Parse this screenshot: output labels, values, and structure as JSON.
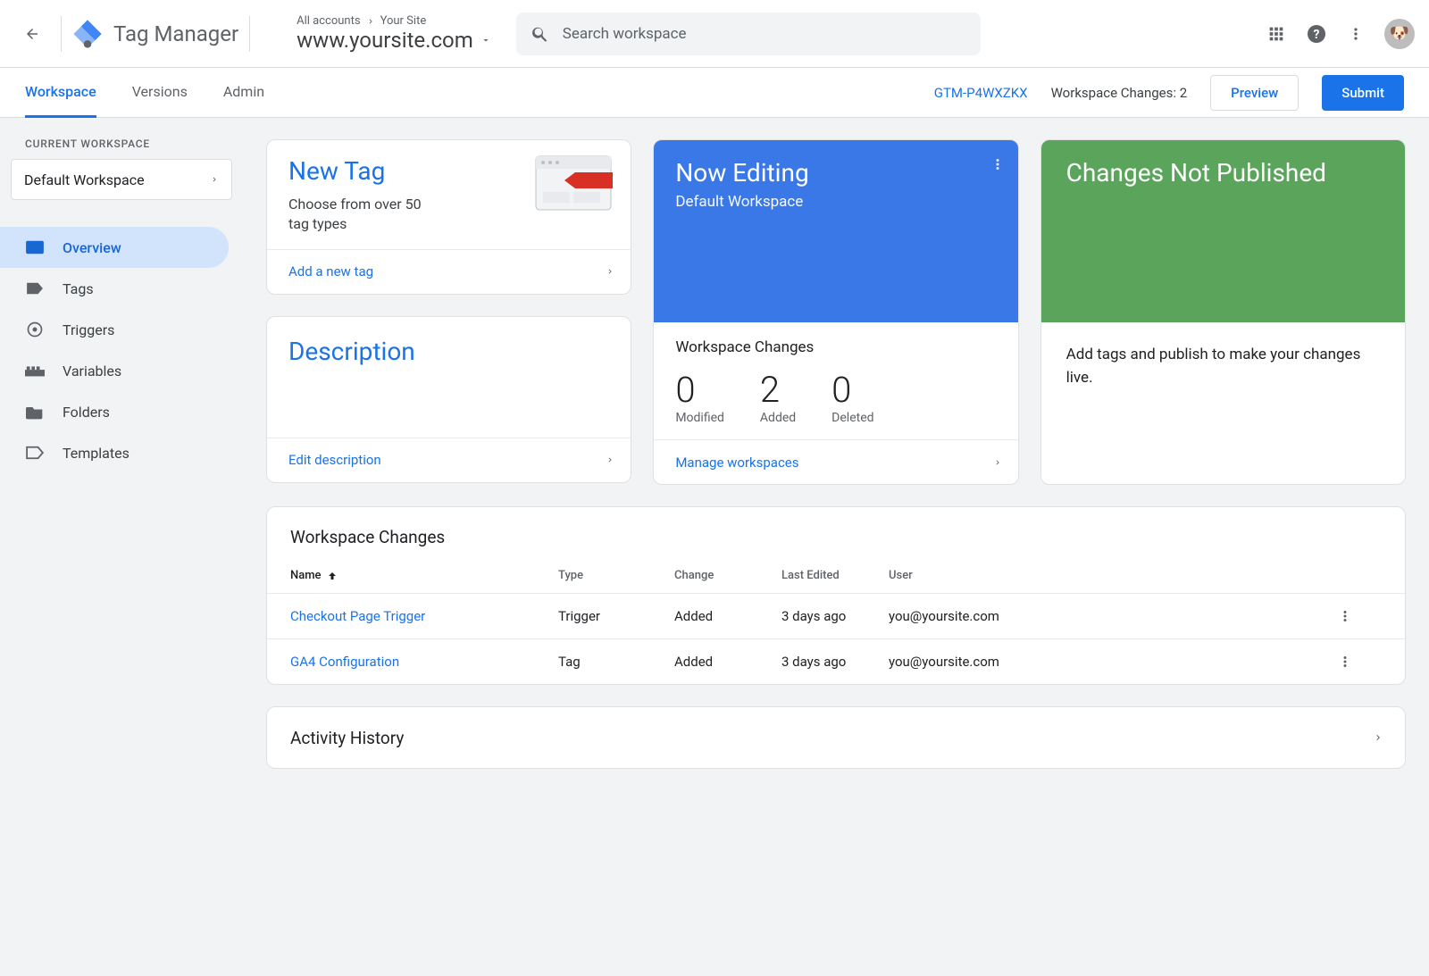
{
  "brand": "Tag Manager",
  "breadcrumb": {
    "root": "All accounts",
    "child": "Your Site"
  },
  "site": "www.yoursite.com",
  "search": {
    "placeholder": "Search workspace"
  },
  "tabs": [
    "Workspace",
    "Versions",
    "Admin"
  ],
  "active_tab": 0,
  "container_id": "GTM-P4WXZKX",
  "workspace_changes_label": "Workspace Changes: 2",
  "preview_btn": "Preview",
  "submit_btn": "Submit",
  "sidebar": {
    "label": "CURRENT WORKSPACE",
    "workspace": "Default Workspace",
    "items": [
      {
        "label": "Overview"
      },
      {
        "label": "Tags"
      },
      {
        "label": "Triggers"
      },
      {
        "label": "Variables"
      },
      {
        "label": "Folders"
      },
      {
        "label": "Templates"
      }
    ]
  },
  "new_tag": {
    "title": "New Tag",
    "sub": "Choose from over 50 tag types",
    "action": "Add a new tag"
  },
  "description": {
    "title": "Description",
    "action": "Edit description"
  },
  "now_editing": {
    "title": "Now Editing",
    "sub": "Default Workspace",
    "stats_title": "Workspace Changes",
    "stats": [
      {
        "num": "0",
        "label": "Modified"
      },
      {
        "num": "2",
        "label": "Added"
      },
      {
        "num": "0",
        "label": "Deleted"
      }
    ],
    "action": "Manage workspaces"
  },
  "changes_not_published": {
    "title": "Changes Not Published",
    "body": "Add tags and publish to make your changes live."
  },
  "changes_table": {
    "title": "Workspace Changes",
    "cols": {
      "name": "Name",
      "type": "Type",
      "change": "Change",
      "last_edited": "Last Edited",
      "user": "User"
    },
    "rows": [
      {
        "name": "Checkout Page Trigger",
        "type": "Trigger",
        "change": "Added",
        "last_edited": "3 days ago",
        "user": "you@yoursite.com"
      },
      {
        "name": "GA4 Configuration",
        "type": "Tag",
        "change": "Added",
        "last_edited": "3 days ago",
        "user": "you@yoursite.com"
      }
    ]
  },
  "activity_history": "Activity History"
}
